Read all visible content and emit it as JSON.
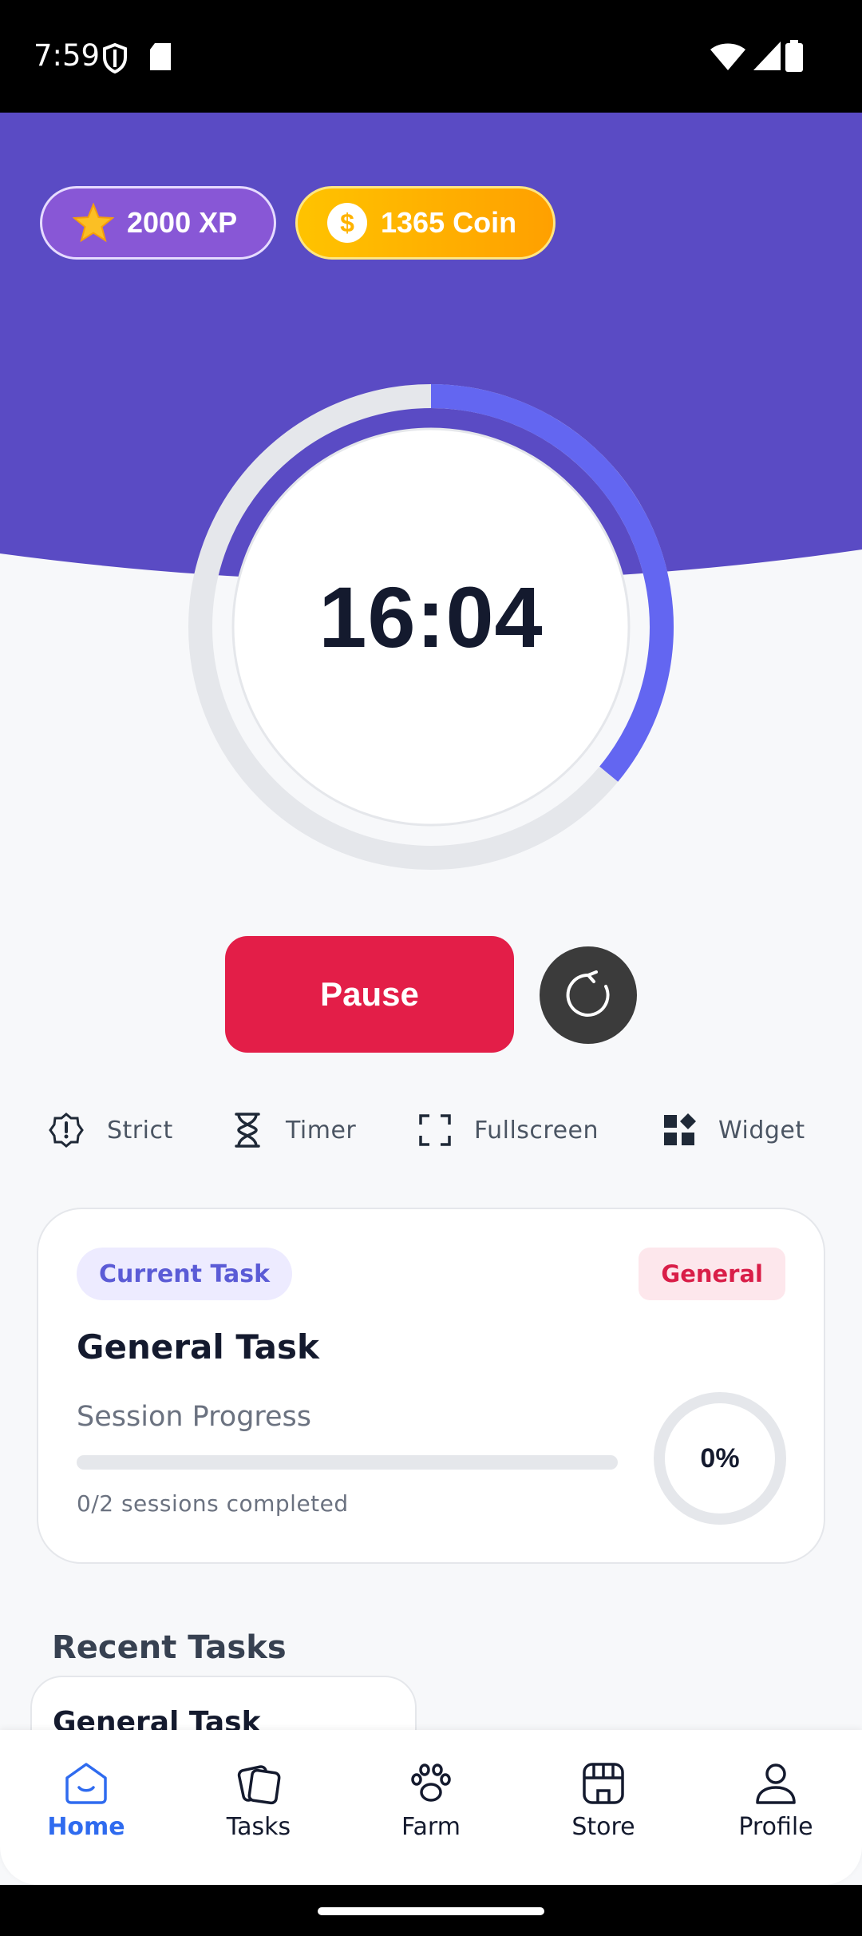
{
  "status_bar": {
    "time": "7:59"
  },
  "header": {
    "xp_label": "2000 XP",
    "coin_label": "1365 Coin",
    "colors": {
      "primary": "#5A4BC4",
      "xp": "#8857D6",
      "coin": "#FFB300"
    }
  },
  "timer": {
    "display": "16:04",
    "progress_fraction": 0.36
  },
  "controls": {
    "pause_label": "Pause",
    "reset_icon": "refresh-icon"
  },
  "options": [
    {
      "icon": "shield-alert-icon",
      "label": "Strict"
    },
    {
      "icon": "hourglass-icon",
      "label": "Timer"
    },
    {
      "icon": "fullscreen-icon",
      "label": "Fullscreen"
    },
    {
      "icon": "widgets-icon",
      "label": "Widget"
    }
  ],
  "task_card": {
    "current_chip": "Current Task",
    "category_chip": "General",
    "title": "General Task",
    "progress_label": "Session Progress",
    "progress_fraction": 0,
    "sessions_text": "0/2 sessions completed",
    "percent_text": "0%"
  },
  "recent": {
    "title": "Recent Tasks",
    "items": [
      {
        "title": "General Task"
      }
    ]
  },
  "nav": [
    {
      "icon": "home-icon",
      "label": "Home",
      "active": true
    },
    {
      "icon": "tasks-icon",
      "label": "Tasks",
      "active": false
    },
    {
      "icon": "paw-icon",
      "label": "Farm",
      "active": false
    },
    {
      "icon": "store-icon",
      "label": "Store",
      "active": false
    },
    {
      "icon": "profile-icon",
      "label": "Profile",
      "active": false
    }
  ]
}
